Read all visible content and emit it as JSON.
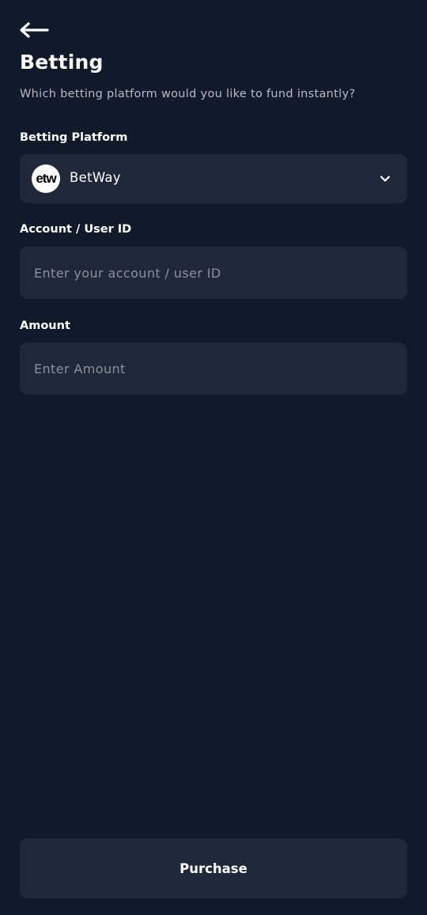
{
  "header": {
    "back_icon": "arrow-left-icon",
    "title": "Betting",
    "subtitle": "Which betting platform would you like to fund instantly?"
  },
  "form": {
    "platform": {
      "label": "Betting Platform",
      "selected_value": "BetWay",
      "logo_text": "etw",
      "dropdown_icon": "chevron-down-icon"
    },
    "account": {
      "label": "Account / User ID",
      "placeholder": "Enter your account / user ID",
      "value": ""
    },
    "amount": {
      "label": "Amount",
      "placeholder": "Enter Amount",
      "value": ""
    }
  },
  "actions": {
    "purchase_label": "Purchase"
  },
  "colors": {
    "background": "#111a2a",
    "field_background": "#1f2839",
    "text_primary": "#ffffff",
    "text_secondary": "#b4bac6",
    "placeholder": "#8a909c"
  }
}
